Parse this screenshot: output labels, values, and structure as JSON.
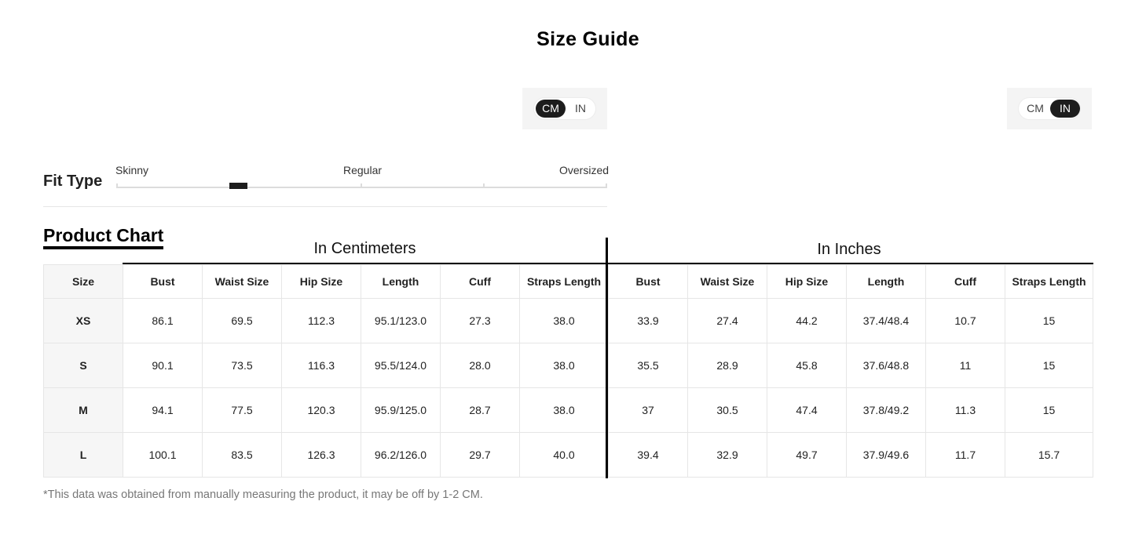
{
  "page_title": "Size Guide",
  "unit_toggle_left": {
    "options": [
      "CM",
      "IN"
    ],
    "selected": "CM"
  },
  "unit_toggle_right": {
    "options": [
      "CM",
      "IN"
    ],
    "selected": "IN"
  },
  "fit_type": {
    "label": "Fit Type",
    "scale": [
      "Skinny",
      "Regular",
      "Oversized"
    ],
    "level": 0.25
  },
  "product_chart": {
    "heading": "Product Chart",
    "group_cm": "In Centimeters",
    "group_in": "In Inches",
    "size_header": "Size",
    "cm_headers": [
      "Bust",
      "Waist Size",
      "Hip Size",
      "Length",
      "Cuff",
      "Straps Length"
    ],
    "in_headers": [
      "Bust",
      "Waist Size",
      "Hip Size",
      "Length",
      "Cuff",
      "Straps Length"
    ],
    "rows": [
      {
        "size": "XS",
        "cm": [
          "86.1",
          "69.5",
          "112.3",
          "95.1/123.0",
          "27.3",
          "38.0"
        ],
        "in": [
          "33.9",
          "27.4",
          "44.2",
          "37.4/48.4",
          "10.7",
          "15"
        ]
      },
      {
        "size": "S",
        "cm": [
          "90.1",
          "73.5",
          "116.3",
          "95.5/124.0",
          "28.0",
          "38.0"
        ],
        "in": [
          "35.5",
          "28.9",
          "45.8",
          "37.6/48.8",
          "11",
          "15"
        ]
      },
      {
        "size": "M",
        "cm": [
          "94.1",
          "77.5",
          "120.3",
          "95.9/125.0",
          "28.7",
          "38.0"
        ],
        "in": [
          "37",
          "30.5",
          "47.4",
          "37.8/49.2",
          "11.3",
          "15"
        ]
      },
      {
        "size": "L",
        "cm": [
          "100.1",
          "83.5",
          "126.3",
          "96.2/126.0",
          "29.7",
          "40.0"
        ],
        "in": [
          "39.4",
          "32.9",
          "49.7",
          "37.9/49.6",
          "11.7",
          "15.7"
        ]
      }
    ]
  },
  "note": "*This data was obtained from manually measuring the product, it may be off by 1-2 CM."
}
